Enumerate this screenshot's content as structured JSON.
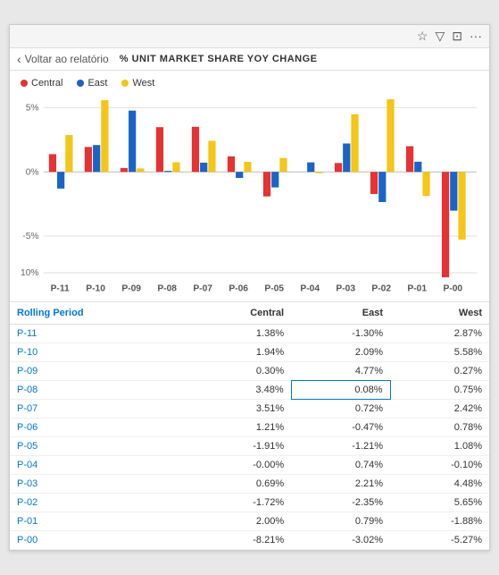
{
  "topbar": {
    "icons": [
      "pin",
      "filter",
      "expand",
      "more"
    ]
  },
  "nav": {
    "back_label": "Voltar ao relatório",
    "title": "% UNIT MARKET SHARE YOY CHANGE"
  },
  "legend": [
    {
      "label": "Central",
      "color": "#e63232"
    },
    {
      "label": "East",
      "color": "#1a64c8"
    },
    {
      "label": "West",
      "color": "#f5c518"
    }
  ],
  "chart": {
    "y_labels": [
      "5%",
      "",
      "0%",
      "",
      "-5%",
      "",
      "-10%"
    ],
    "x_labels": [
      "P-11",
      "P-10",
      "P-09",
      "P-08",
      "P-07",
      "P-06",
      "P-05",
      "P-04",
      "P-03",
      "P-02",
      "P-01",
      "P-00"
    ]
  },
  "table": {
    "headers": [
      "Rolling Period",
      "Central",
      "East",
      "West"
    ],
    "rows": [
      [
        "P-11",
        "1.38%",
        "-1.30%",
        "2.87%"
      ],
      [
        "P-10",
        "1.94%",
        "2.09%",
        "5.58%"
      ],
      [
        "P-09",
        "0.30%",
        "4.77%",
        "0.27%"
      ],
      [
        "P-08",
        "3.48%",
        "0.08%",
        "0.75%"
      ],
      [
        "P-07",
        "3.51%",
        "0.72%",
        "2.42%"
      ],
      [
        "P-06",
        "1.21%",
        "-0.47%",
        "0.78%"
      ],
      [
        "P-05",
        "-1.91%",
        "-1.21%",
        "1.08%"
      ],
      [
        "P-04",
        "-0.00%",
        "0.74%",
        "-0.10%"
      ],
      [
        "P-03",
        "0.69%",
        "2.21%",
        "4.48%"
      ],
      [
        "P-02",
        "-1.72%",
        "-2.35%",
        "5.65%"
      ],
      [
        "P-01",
        "2.00%",
        "0.79%",
        "-1.88%"
      ],
      [
        "P-00",
        "-8.21%",
        "-3.02%",
        "-5.27%"
      ]
    ],
    "highlighted_cell": {
      "row": 3,
      "col": 1
    }
  }
}
